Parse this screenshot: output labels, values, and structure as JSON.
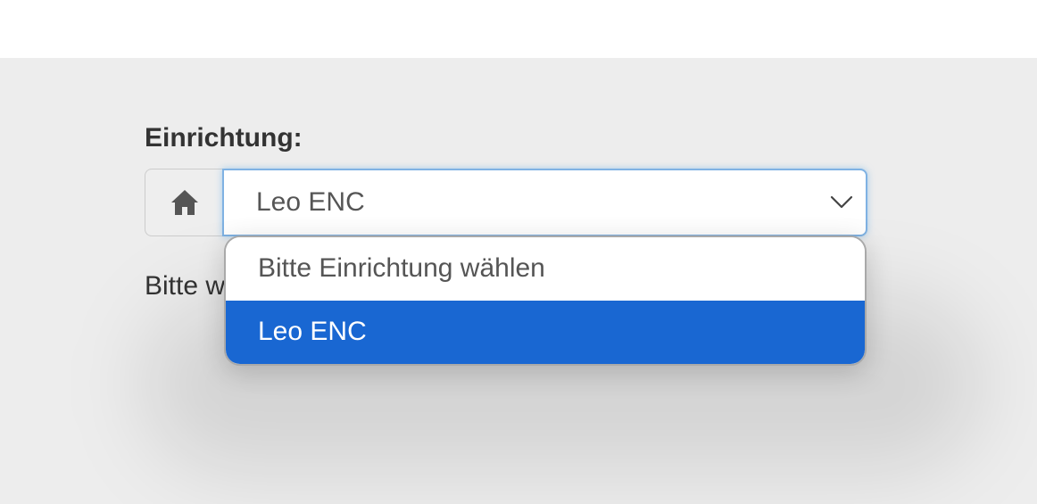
{
  "form": {
    "label": "Einrichtung:",
    "addon_icon": "home-icon",
    "select": {
      "selected_value": "Leo ENC",
      "chevron_icon": "chevron-down-icon"
    },
    "help_text": "Bitte w",
    "dropdown": {
      "options": [
        {
          "label": "Bitte Einrichtung wählen",
          "selected": false
        },
        {
          "label": "Leo ENC",
          "selected": true
        }
      ],
      "highlight_color": "#1967d2"
    }
  },
  "colors": {
    "panel_background": "#ededed",
    "focus_border": "#7fb2e3",
    "text": "#333333"
  }
}
